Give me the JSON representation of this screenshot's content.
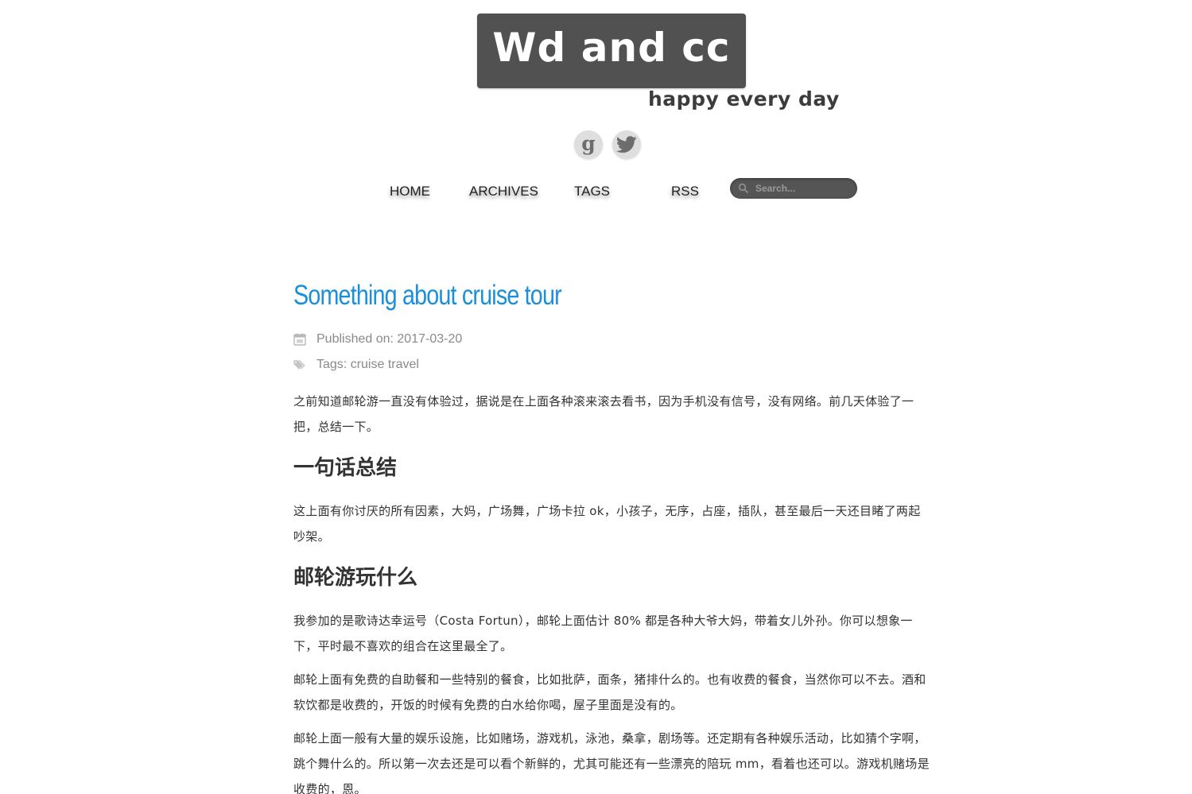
{
  "site": {
    "logo_text": "Wd and cc",
    "tagline": "happy every day"
  },
  "social": [
    {
      "name": "google",
      "icon": "google-icon"
    },
    {
      "name": "twitter",
      "icon": "twitter-icon"
    }
  ],
  "nav": {
    "home": "HOME",
    "archives": "ARCHIVES",
    "tags": "TAGS",
    "rss": "RSS"
  },
  "search": {
    "placeholder": "Search..."
  },
  "post": {
    "title": "Something about cruise tour",
    "published": "Published on: 2017-03-20",
    "tags": "Tags: cruise travel",
    "intro": "之前知道邮轮游一直没有体验过，据说是在上面各种滚来滚去看书，因为手机没有信号，没有网络。前几天体验了一把，总结一下。",
    "section1_heading": "一句话总结",
    "section1_text": "这上面有你讨厌的所有因素，大妈，广场舞，广场卡拉 ok，小孩子，无序，占座，插队，甚至最后一天还目睹了两起吵架。",
    "section2_heading": "邮轮游玩什么",
    "section2_p1": "我参加的是歌诗达幸运号（Costa Fortun），邮轮上面估计 80% 都是各种大爷大妈，带着女儿外孙。你可以想象一下，平时最不喜欢的组合在这里最全了。",
    "section2_p2": "邮轮上面有免费的自助餐和一些特别的餐食，比如批萨，面条，猪排什么的。也有收费的餐食，当然你可以不去。酒和软饮都是收费的，开饭的时候有免费的白水给你喝，屋子里面是没有的。",
    "section2_p3": "邮轮上面一般有大量的娱乐设施，比如赌场，游戏机，泳池，桑拿，剧场等。还定期有各种娱乐活动，比如猜个字啊，跳个舞什么的。所以第一次去还是可以看个新鲜的，尤其可能还有一些漂亮的陪玩 mm，看着也还可以。游戏机赌场是收费的，恩。"
  },
  "colors": {
    "title_blue": "#1a8fdb",
    "logo_bg": "#515151",
    "meta_gray": "#8a8a8a"
  }
}
